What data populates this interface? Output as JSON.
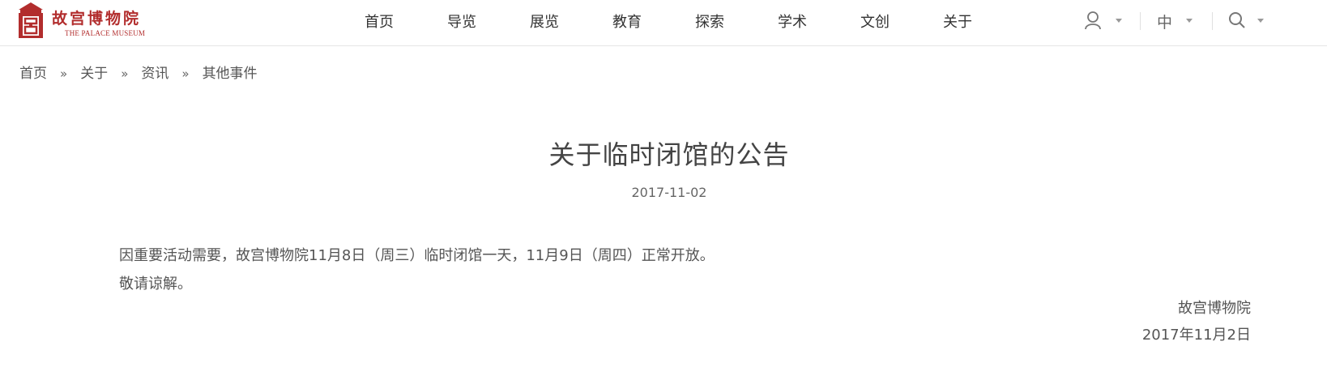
{
  "logo": {
    "name": "故宫博物院",
    "subtitle": "THE PALACE MUSEUM"
  },
  "nav": {
    "items": [
      "首页",
      "导览",
      "展览",
      "教育",
      "探索",
      "学术",
      "文创",
      "关于"
    ]
  },
  "tools": {
    "user_icon": "user-icon",
    "language": "中",
    "search_icon": "search-icon"
  },
  "breadcrumb": {
    "items": [
      "首页",
      "关于",
      "资讯",
      "其他事件"
    ],
    "separator": "»"
  },
  "article": {
    "title": "关于临时闭馆的公告",
    "date": "2017-11-02",
    "paragraphs": [
      "因重要活动需要，故宫博物院11月8日（周三）临时闭馆一天，11月9日（周四）正常开放。",
      "敬请谅解。"
    ],
    "signature": "故宫博物院",
    "signature_date": "2017年11月2日"
  },
  "colors": {
    "brand_red": "#b22d2d",
    "text": "#333333",
    "muted": "#999999"
  }
}
